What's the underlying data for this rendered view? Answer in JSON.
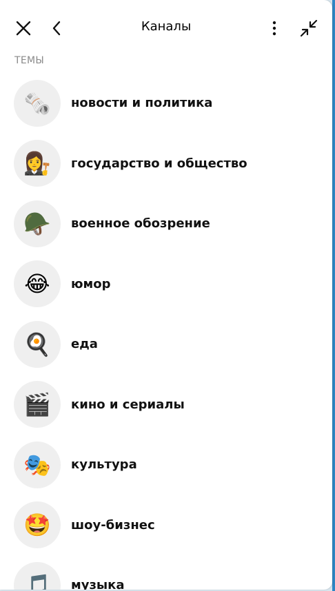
{
  "header": {
    "title": "Каналы"
  },
  "section": {
    "label": "ТЕМЫ"
  },
  "topics": [
    {
      "label": "новости и политика",
      "icon": "🗞️",
      "icon_name": "newspaper-icon"
    },
    {
      "label": "государство и общество",
      "icon": "👩‍⚖️",
      "icon_name": "judge-icon"
    },
    {
      "label": "военное обозрение",
      "icon": "🪖",
      "icon_name": "military-helmet-icon"
    },
    {
      "label": "юмор",
      "icon": "😂",
      "icon_name": "tears-of-joy-icon"
    },
    {
      "label": "еда",
      "icon": "🍳",
      "icon_name": "frying-pan-icon"
    },
    {
      "label": "кино и сериалы",
      "icon": "🎬",
      "icon_name": "clapper-board-icon"
    },
    {
      "label": "культура",
      "icon": "🎭",
      "icon_name": "theater-masks-icon"
    },
    {
      "label": "шоу-бизнес",
      "icon": "🤩",
      "icon_name": "star-struck-icon"
    },
    {
      "label": "музыка",
      "icon": "🎵",
      "icon_name": "music-note-icon"
    }
  ],
  "colors": {
    "background": "#ffffff",
    "icon_circle": "#efefef",
    "section_label": "#8a8a8a",
    "accent_strip": "#2f86c4"
  }
}
